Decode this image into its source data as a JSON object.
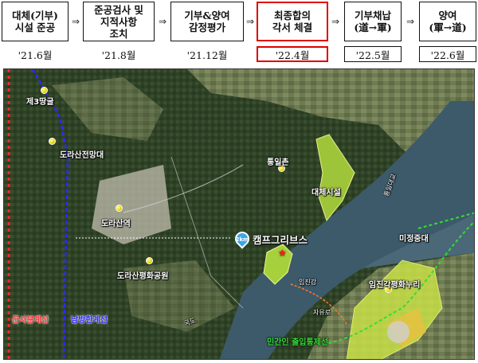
{
  "timeline": {
    "steps": [
      {
        "title": "대체(기부)\n시설 준공",
        "date": "'21.6월"
      },
      {
        "title": "준공검사 및\n지적사항\n조치",
        "date": "'21.8월"
      },
      {
        "title": "기부&양여\n감정평가",
        "date": "'21.12월"
      },
      {
        "title": "최종합의\n각서 체결",
        "date": "'22.4월"
      },
      {
        "title": "기부채납\n(道→軍)",
        "date": "'22.5월"
      },
      {
        "title": "양여\n(軍→道)",
        "date": "'22.6월"
      }
    ],
    "arrow": "⇒"
  },
  "map": {
    "labels": {
      "jeil": "제3땅굴",
      "dorasan_obs": "도라산전망대",
      "dorasan_station": "도라산역",
      "peace_park": "도라산평화공원",
      "tongil": "통일촌",
      "replacement": "대체시설",
      "camp": "캠프그리브스",
      "mijeong": "미정중대",
      "imjingak": "임진각평화누리",
      "military_line": "군사분계선",
      "south_limit": "남방한계선",
      "civilian_line": "민간인 출입통제선",
      "road1": "자유로",
      "road2": "통일대교",
      "road3": "임진강",
      "road4": "국도",
      "distance": "2km"
    },
    "colors": {
      "military_line": "#ff3030",
      "south_limit": "#2a2aff",
      "civilian_line": "#33dd33",
      "highlight": "#e00000"
    }
  }
}
